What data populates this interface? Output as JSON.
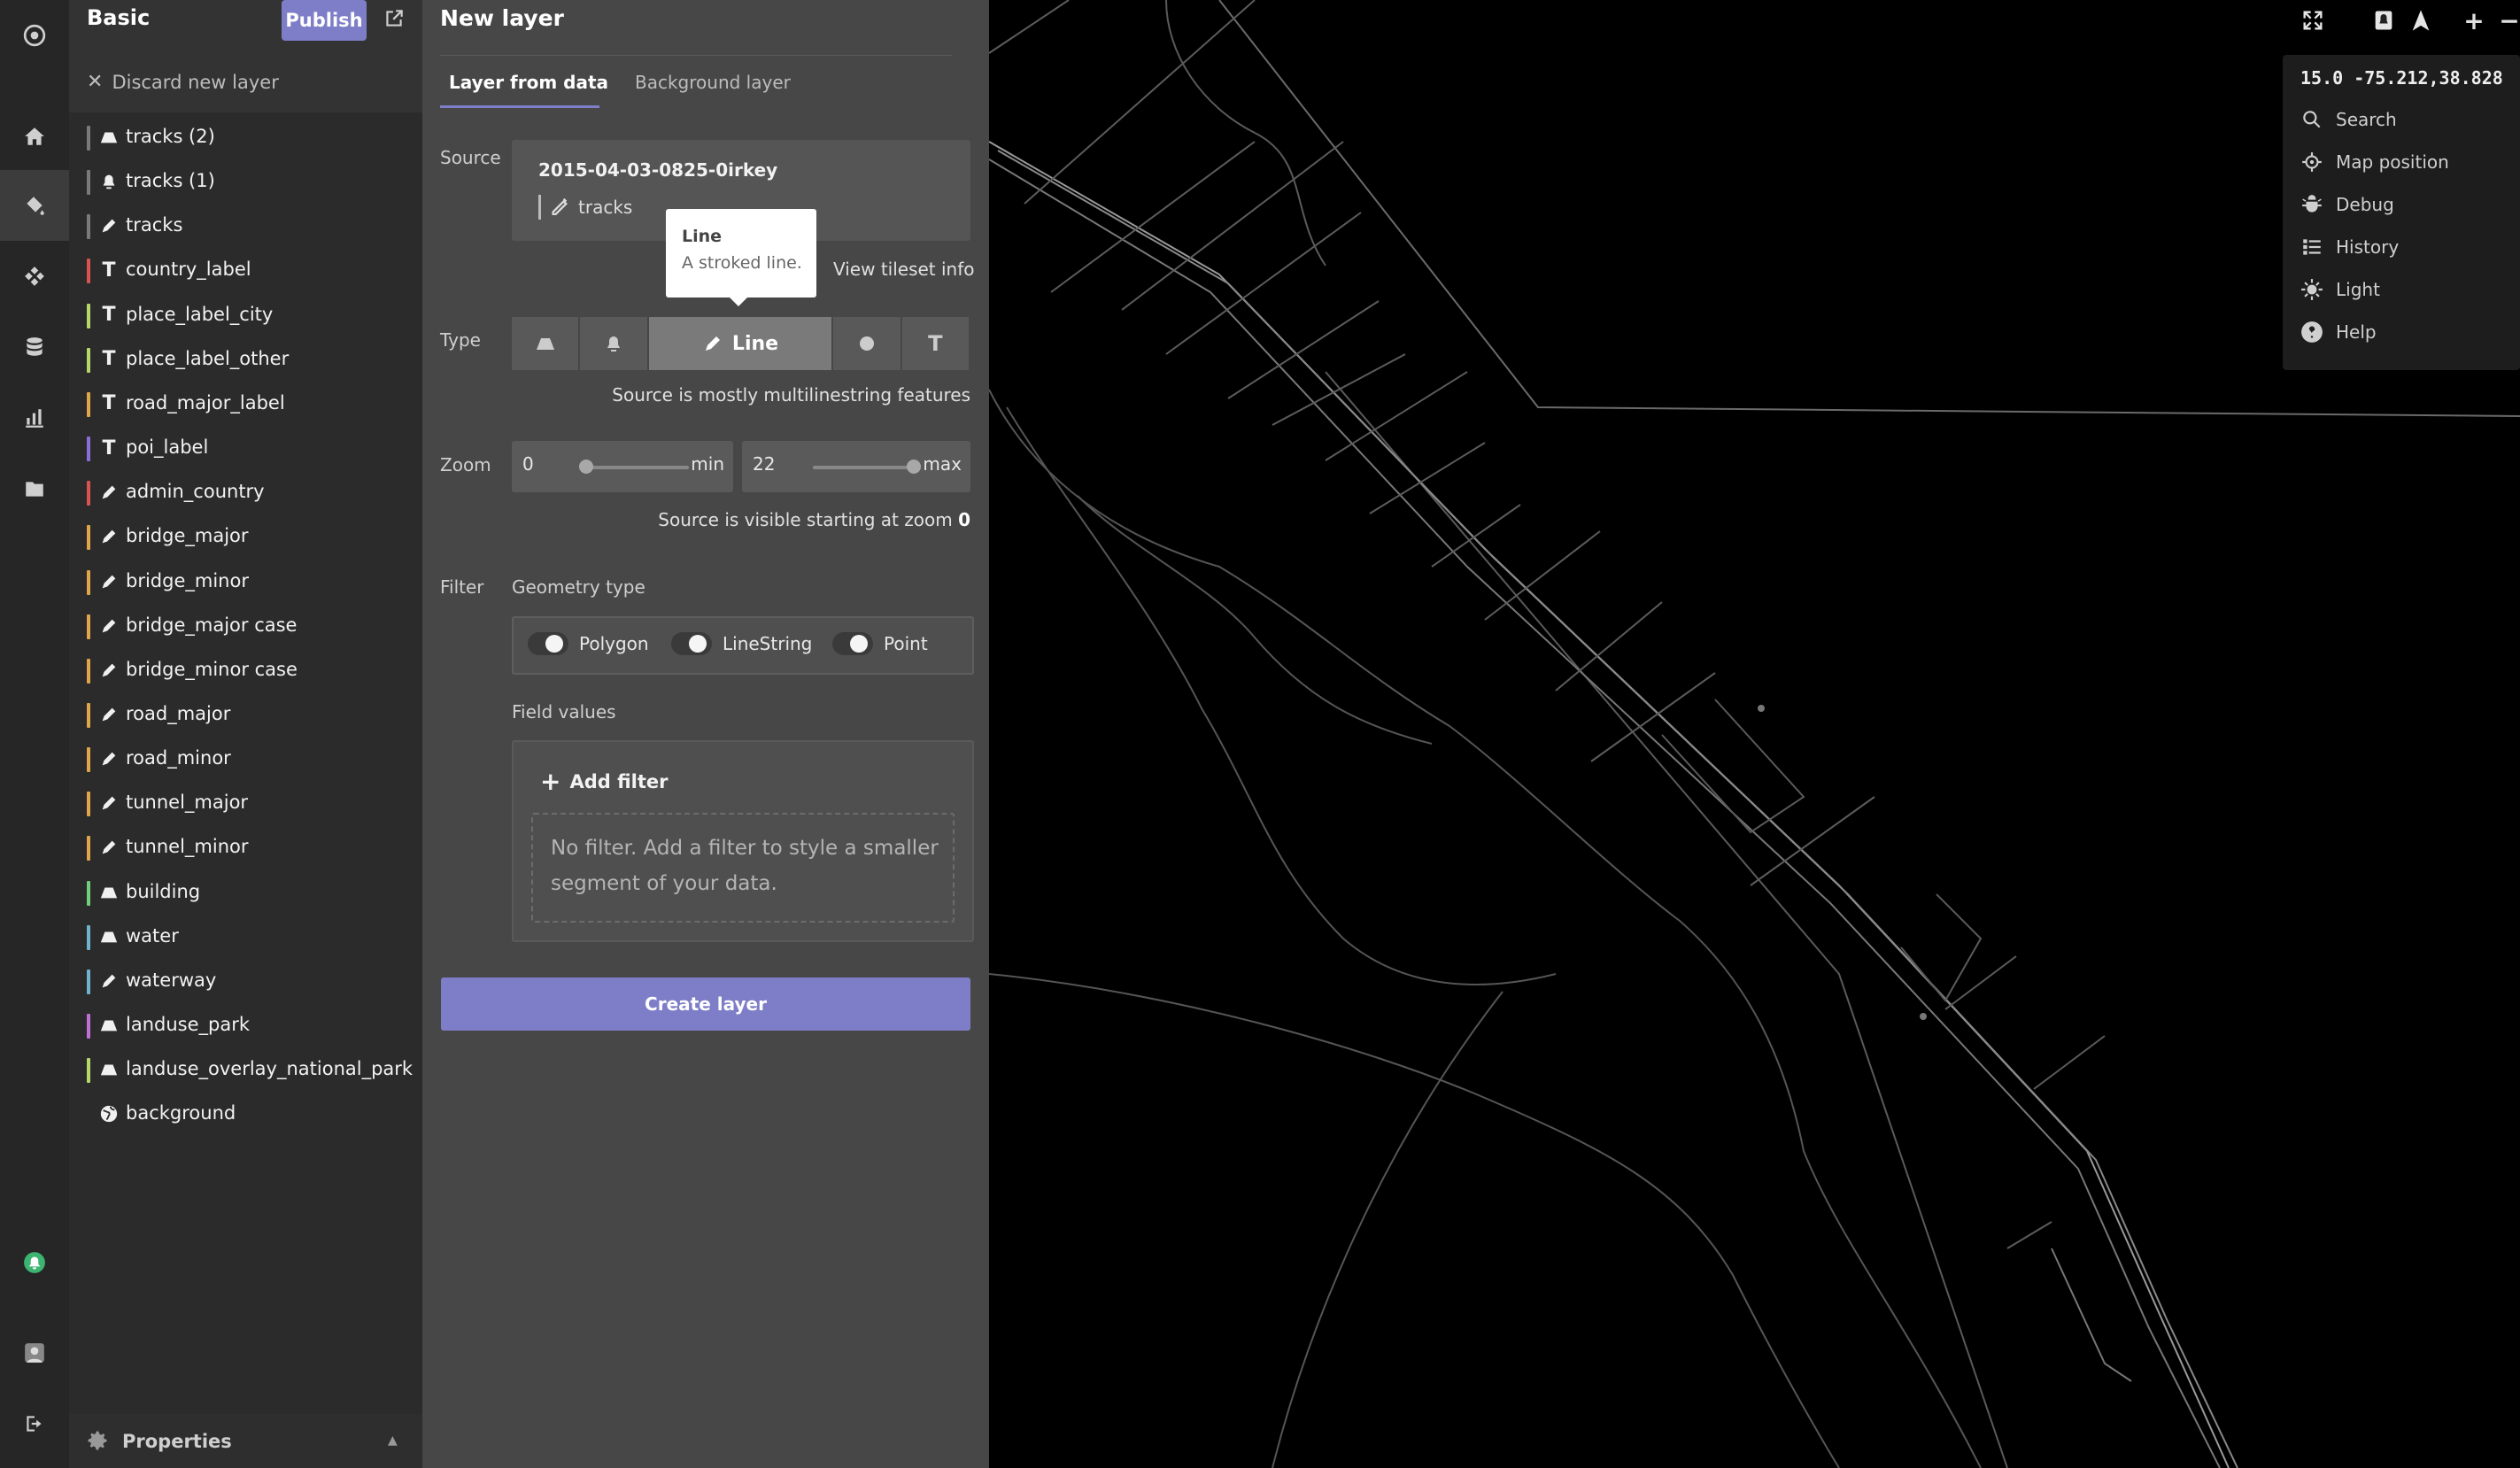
{
  "nav": {
    "icons": [
      "logo-icon",
      "home-icon",
      "paint-bucket-icon",
      "nodes-icon",
      "database-icon",
      "bar-chart-icon",
      "folder-icon",
      "notification-icon",
      "avatar",
      "logout-icon"
    ]
  },
  "layers_panel": {
    "style_name": "Basic",
    "publish_label": "Publish",
    "discard_label": "Discard new layer",
    "properties_label": "Properties",
    "layers": [
      {
        "name": "tracks (2)",
        "icon": "polygon",
        "color": "#7a7a7a"
      },
      {
        "name": "tracks (1)",
        "icon": "symbol",
        "color": "#7a7a7a"
      },
      {
        "name": "tracks",
        "icon": "line",
        "color": "#7a7a7a"
      },
      {
        "name": "country_label",
        "icon": "text",
        "color": "#d9534f"
      },
      {
        "name": "place_label_city",
        "icon": "text",
        "color": "#b5d86b"
      },
      {
        "name": "place_label_other",
        "icon": "text",
        "color": "#b5d86b"
      },
      {
        "name": "road_major_label",
        "icon": "text",
        "color": "#e0a64a"
      },
      {
        "name": "poi_label",
        "icon": "text",
        "color": "#8a6fd9"
      },
      {
        "name": "admin_country",
        "icon": "line",
        "color": "#d9534f"
      },
      {
        "name": "bridge_major",
        "icon": "line",
        "color": "#e0a64a"
      },
      {
        "name": "bridge_minor",
        "icon": "line",
        "color": "#e0a64a"
      },
      {
        "name": "bridge_major case",
        "icon": "line",
        "color": "#e0a64a"
      },
      {
        "name": "bridge_minor case",
        "icon": "line",
        "color": "#e0a64a"
      },
      {
        "name": "road_major",
        "icon": "line",
        "color": "#e0a64a"
      },
      {
        "name": "road_minor",
        "icon": "line",
        "color": "#e0a64a"
      },
      {
        "name": "tunnel_major",
        "icon": "line",
        "color": "#e0a64a"
      },
      {
        "name": "tunnel_minor",
        "icon": "line",
        "color": "#e0a64a"
      },
      {
        "name": "building",
        "icon": "polygon",
        "color": "#6fcf7a"
      },
      {
        "name": "water",
        "icon": "polygon",
        "color": "#6fb3cf"
      },
      {
        "name": "waterway",
        "icon": "line",
        "color": "#6fb3cf"
      },
      {
        "name": "landuse_park",
        "icon": "polygon",
        "color": "#c06fd9"
      },
      {
        "name": "landuse_overlay_national_park",
        "icon": "polygon",
        "color": "#b5d86b"
      },
      {
        "name": "background",
        "icon": "globe",
        "color": ""
      }
    ]
  },
  "editor": {
    "title": "New layer",
    "tabs": [
      "Layer from data",
      "Background layer"
    ],
    "source_label": "Source",
    "source_name": "2015-04-03-0825-0irkey",
    "source_layer": "tracks",
    "view_tileset_label": "View tileset info",
    "type_label": "Type",
    "type_selected": "Line",
    "type_note": "Source is mostly multilinestring features",
    "zoom_label": "Zoom",
    "zoom_min": "0",
    "zoom_min_label": "min",
    "zoom_max": "22",
    "zoom_max_label": "max",
    "zoom_note": "Source is visible starting at zoom",
    "zoom_note_value": "0",
    "filter_label": "Filter",
    "geometry_type_label": "Geometry type",
    "geometry_types": [
      "Polygon",
      "LineString",
      "Point"
    ],
    "field_values_label": "Field values",
    "add_filter_label": "Add filter",
    "no_filter_text": "No filter. Add a filter to style a smaller segment of your data.",
    "create_label": "Create layer"
  },
  "tooltip": {
    "title": "Line",
    "text": "A stroked line."
  },
  "map_tools": {
    "coords": "15.0 -75.212,38.828",
    "items": [
      {
        "label": "Search",
        "icon": "search-icon"
      },
      {
        "label": "Map position",
        "icon": "crosshair-icon"
      },
      {
        "label": "Debug",
        "icon": "bug-icon"
      },
      {
        "label": "History",
        "icon": "history-icon"
      },
      {
        "label": "Light",
        "icon": "sun-icon"
      },
      {
        "label": "Help",
        "icon": "help-icon"
      }
    ]
  },
  "colors": {
    "accent": "#7e7ec8"
  }
}
